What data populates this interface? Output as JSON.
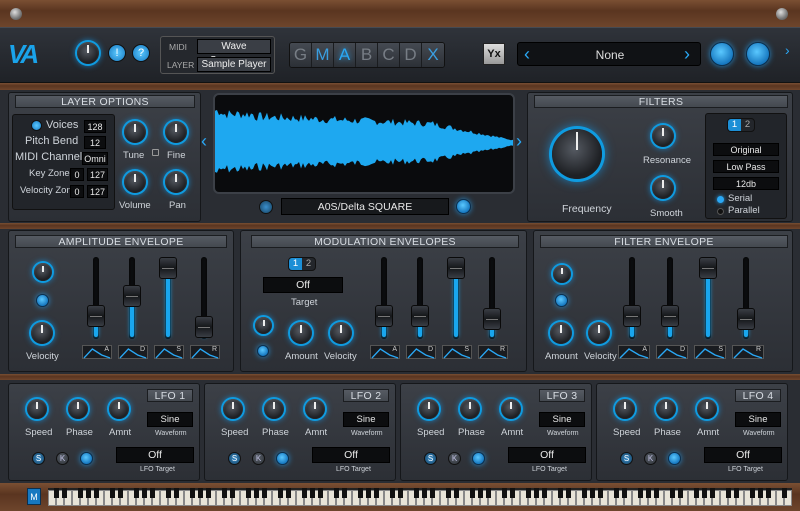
{
  "header": {
    "midi_label": "MIDI",
    "layer_label": "LAYER",
    "midi_value": "Wave Sequencer",
    "layer_value": "Sample Player",
    "layer_buttons": [
      "G",
      "M",
      "A",
      "B",
      "C",
      "D",
      "X"
    ],
    "preset_name": "None",
    "swap_label": "Yx",
    "help_label": "?",
    "info_label": "!"
  },
  "layer_options": {
    "title": "LAYER OPTIONS",
    "voices_label": "Voices",
    "voices_value": "128",
    "pitch_bend_label": "Pitch Bend",
    "pitch_bend_value": "12",
    "midi_channel_label": "MIDI Channel",
    "midi_channel_value": "Omni",
    "key_zone_label": "Key Zone",
    "key_zone_low": "0",
    "key_zone_high": "127",
    "velocity_zone_label": "Velocity Zone",
    "velocity_zone_low": "0",
    "velocity_zone_high": "127",
    "tune_label": "Tune",
    "fine_label": "Fine",
    "volume_label": "Volume",
    "pan_label": "Pan"
  },
  "waveform": {
    "sample_name": "A0S/Delta SQUARE"
  },
  "filters": {
    "title": "FILTERS",
    "tabs": [
      "1",
      "2"
    ],
    "mode": "Original",
    "type": "Low Pass",
    "slope": "12db",
    "frequency_label": "Frequency",
    "resonance_label": "Resonance",
    "smooth_label": "Smooth",
    "serial_label": "Serial",
    "parallel_label": "Parallel"
  },
  "amp_env": {
    "title": "AMPLITUDE ENVELOPE",
    "velocity_label": "Velocity",
    "stages": [
      "A",
      "D",
      "S",
      "R"
    ],
    "levels": [
      0.3,
      0.55,
      0.95,
      0.15
    ]
  },
  "mod_env": {
    "title": "MODULATION ENVELOPES",
    "tabs": [
      "1",
      "2"
    ],
    "target_value": "Off",
    "target_label": "Target",
    "amount_label": "Amount",
    "velocity_label": "Velocity",
    "stages": [
      "A",
      "D",
      "S",
      "R"
    ],
    "levels": [
      0.3,
      0.3,
      0.95,
      0.25
    ]
  },
  "filter_env": {
    "title": "FILTER ENVELOPE",
    "amount_label": "Amount",
    "velocity_label": "Velocity",
    "stages": [
      "A",
      "D",
      "S",
      "R"
    ],
    "levels": [
      0.3,
      0.3,
      0.95,
      0.25
    ]
  },
  "lfos": [
    {
      "title": "LFO 1",
      "speed": "Speed",
      "phase": "Phase",
      "amnt": "Amnt",
      "waveform": "Sine",
      "waveform_label": "Waveform",
      "target": "Off",
      "target_label": "LFO Target",
      "s": "S",
      "k": "K"
    },
    {
      "title": "LFO 2",
      "speed": "Speed",
      "phase": "Phase",
      "amnt": "Amnt",
      "waveform": "Sine",
      "waveform_label": "Waveform",
      "target": "Off",
      "target_label": "LFO Target",
      "s": "S",
      "k": "K"
    },
    {
      "title": "LFO 3",
      "speed": "Speed",
      "phase": "Phase",
      "amnt": "Amnt",
      "waveform": "Sine",
      "waveform_label": "Waveform",
      "target": "Off",
      "target_label": "LFO Target",
      "s": "S",
      "k": "K"
    },
    {
      "title": "LFO 4",
      "speed": "Speed",
      "phase": "Phase",
      "amnt": "Amnt",
      "waveform": "Sine",
      "waveform_label": "Waveform",
      "target": "Off",
      "target_label": "LFO Target",
      "s": "S",
      "k": "K"
    }
  ],
  "keyboard": {
    "m_label": "M"
  },
  "colors": {
    "accent": "#19a6ee",
    "wood": "#6a4129",
    "wave": "#1ea8f0"
  }
}
